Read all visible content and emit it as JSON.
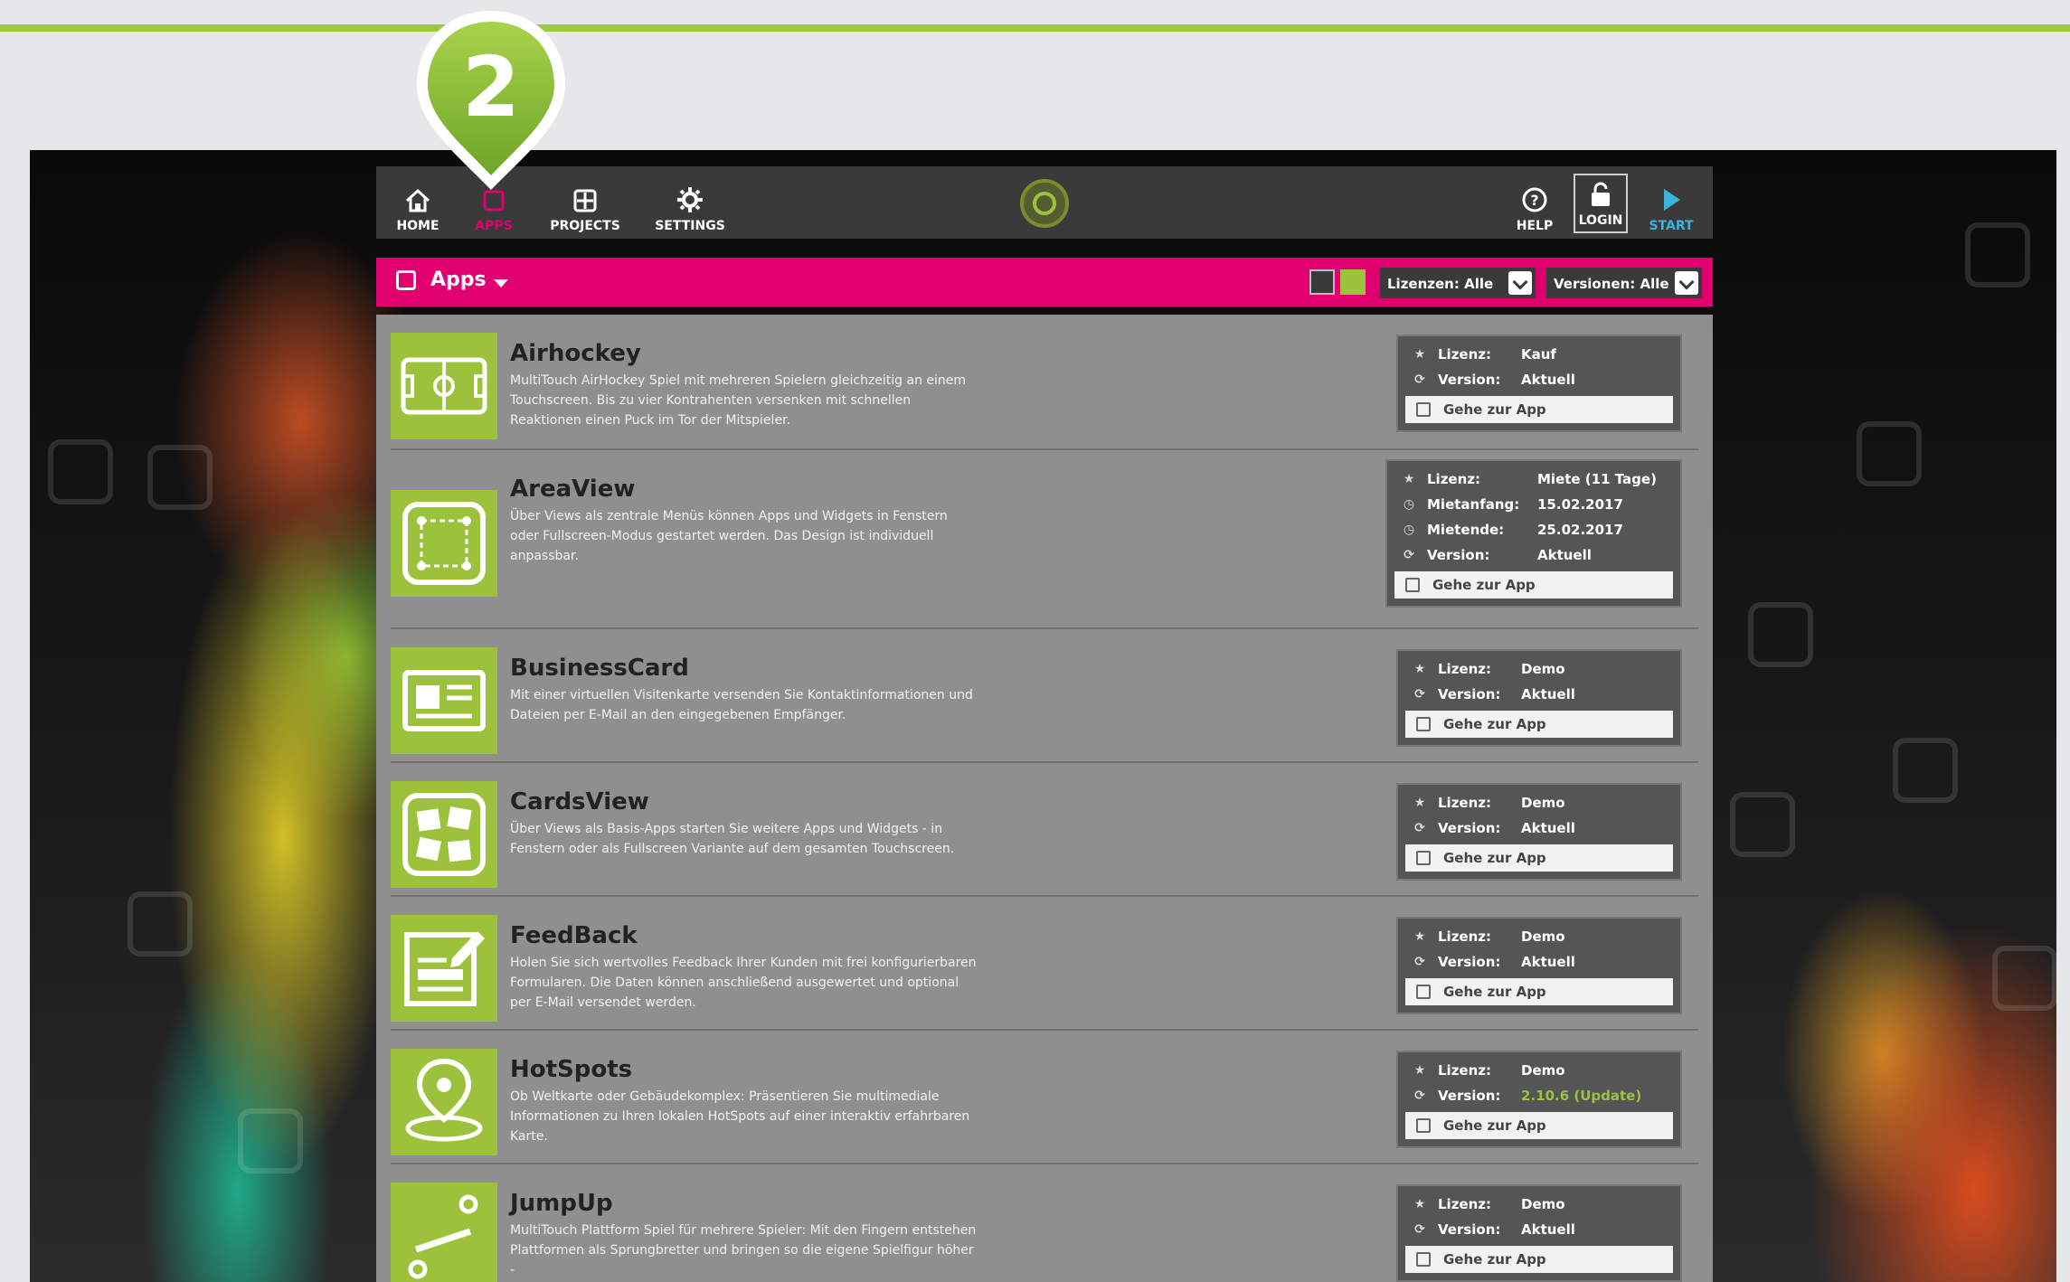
{
  "step_marker": "2",
  "nav": {
    "home": "HOME",
    "apps": "APPS",
    "projects": "PROJECTS",
    "settings": "SETTINGS",
    "help": "HELP",
    "login": "LOGIN",
    "start": "START"
  },
  "section": {
    "title": "Apps",
    "license_filter": "Lizenzen: Alle",
    "version_filter": "Versionen: Alle"
  },
  "goto_label": "Gehe zur App",
  "apps": [
    {
      "name": "Airhockey",
      "description": "MultiTouch AirHockey Spiel mit mehreren Spielern gleichzeitig an einem Touchscreen. Bis zu vier Kontrahenten versenken mit schnellen Reaktionen einen Puck im Tor der Mitspieler.",
      "fields": [
        {
          "icon": "star-icon",
          "label": "Lizenz:",
          "value": "Kauf"
        },
        {
          "icon": "refresh-icon",
          "label": "Version:",
          "value": "Aktuell"
        }
      ]
    },
    {
      "name": "AreaView",
      "description": "Über Views als zentrale Menüs können Apps und Widgets in Fenstern oder Fullscreen-Modus gestartet werden. Das Design ist individuell anpassbar.",
      "fields": [
        {
          "icon": "star-icon",
          "label": "Lizenz:",
          "value": "Miete (11 Tage)"
        },
        {
          "icon": "clock-icon",
          "label": "Mietanfang:",
          "value": "15.02.2017"
        },
        {
          "icon": "clock-icon",
          "label": "Mietende:",
          "value": "25.02.2017"
        },
        {
          "icon": "refresh-icon",
          "label": "Version:",
          "value": "Aktuell"
        }
      ]
    },
    {
      "name": "BusinessCard",
      "description": "Mit einer virtuellen Visitenkarte versenden Sie Kontaktinformationen und Dateien per E-Mail an den eingegebenen Empfänger.",
      "fields": [
        {
          "icon": "star-icon",
          "label": "Lizenz:",
          "value": "Demo"
        },
        {
          "icon": "refresh-icon",
          "label": "Version:",
          "value": "Aktuell"
        }
      ]
    },
    {
      "name": "CardsView",
      "description": "Über Views als Basis-Apps starten Sie weitere Apps und Widgets - in Fenstern oder als Fullscreen Variante auf dem gesamten Touchscreen.",
      "fields": [
        {
          "icon": "star-icon",
          "label": "Lizenz:",
          "value": "Demo"
        },
        {
          "icon": "refresh-icon",
          "label": "Version:",
          "value": "Aktuell"
        }
      ]
    },
    {
      "name": "FeedBack",
      "description": "Holen Sie sich wertvolles Feedback Ihrer Kunden mit frei konfigurierbaren Formularen. Die Daten können anschließend ausgewertet und optional per E-Mail versendet werden.",
      "fields": [
        {
          "icon": "star-icon",
          "label": "Lizenz:",
          "value": "Demo"
        },
        {
          "icon": "refresh-icon",
          "label": "Version:",
          "value": "Aktuell"
        }
      ]
    },
    {
      "name": "HotSpots",
      "description": "Ob Weltkarte oder Gebäudekomplex: Präsentieren Sie multimediale Informationen zu Ihren lokalen HotSpots auf einer interaktiv erfahrbaren Karte.",
      "fields": [
        {
          "icon": "star-icon",
          "label": "Lizenz:",
          "value": "Demo"
        },
        {
          "icon": "refresh-icon",
          "label": "Version:",
          "value": "2.10.6 (Update)"
        }
      ]
    },
    {
      "name": "JumpUp",
      "description": "MultiTouch Plattform Spiel für mehrere Spieler: Mit den Fingern entstehen Plattformen als Sprungbretter und bringen so die eigene Spielfigur höher -",
      "fields": [
        {
          "icon": "star-icon",
          "label": "Lizenz:",
          "value": "Demo"
        },
        {
          "icon": "refresh-icon",
          "label": "Version:",
          "value": "Aktuell"
        }
      ]
    }
  ],
  "colors": {
    "accent_green": "#9cc23c",
    "accent_magenta": "#e0006f",
    "start_blue": "#3ab4d8"
  }
}
